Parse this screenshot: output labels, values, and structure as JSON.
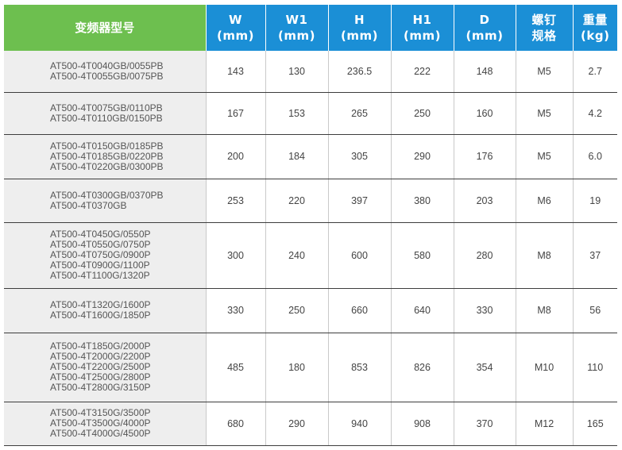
{
  "headers": {
    "model": "变频器型号",
    "w": {
      "label": "W",
      "unit": "(mm)"
    },
    "w1": {
      "label": "W1",
      "unit": "(mm)"
    },
    "h": {
      "label": "H",
      "unit": "(mm)"
    },
    "h1": {
      "label": "H1",
      "unit": "(mm)"
    },
    "d": {
      "label": "D",
      "unit": "(mm)"
    },
    "screw": {
      "line1": "螺钉",
      "line2": "规格"
    },
    "weight": {
      "line1": "重量",
      "line2": "(kg)"
    }
  },
  "rows": [
    {
      "models": [
        "AT500-4T0040GB/0055PB",
        "AT500-4T0055GB/0075PB"
      ],
      "w": "143",
      "w1": "130",
      "h": "236.5",
      "h1": "222",
      "d": "148",
      "screw": "M5",
      "weight": "2.7"
    },
    {
      "models": [
        "AT500-4T0075GB/0110PB",
        "AT500-4T0110GB/0150PB"
      ],
      "w": "167",
      "w1": "153",
      "h": "265",
      "h1": "250",
      "d": "160",
      "screw": "M5",
      "weight": "4.2"
    },
    {
      "models": [
        "AT500-4T0150GB/0185PB",
        "AT500-4T0185GB/0220PB",
        "AT500-4T0220GB/0300PB"
      ],
      "w": "200",
      "w1": "184",
      "h": "305",
      "h1": "290",
      "d": "176",
      "screw": "M5",
      "weight": "6.0"
    },
    {
      "models": [
        "AT500-4T0300GB/0370PB",
        "AT500-4T0370GB"
      ],
      "w": "253",
      "w1": "220",
      "h": "397",
      "h1": "380",
      "d": "203",
      "screw": "M6",
      "weight": "19"
    },
    {
      "models": [
        "AT500-4T0450G/0550P",
        "AT500-4T0550G/0750P",
        "AT500-4T0750G/0900P",
        "AT500-4T0900G/1100P",
        "AT500-4T1100G/1320P"
      ],
      "w": "300",
      "w1": "240",
      "h": "600",
      "h1": "580",
      "d": "280",
      "screw": "M8",
      "weight": "37"
    },
    {
      "models": [
        "AT500-4T1320G/1600P",
        "AT500-4T1600G/1850P"
      ],
      "w": "330",
      "w1": "250",
      "h": "660",
      "h1": "640",
      "d": "330",
      "screw": "M8",
      "weight": "56"
    },
    {
      "models": [
        "AT500-4T1850G/2000P",
        "AT500-4T2000G/2200P",
        "AT500-4T2200G/2500P",
        "AT500-4T2500G/2800P",
        "AT500-4T2800G/3150P"
      ],
      "w": "485",
      "w1": "180",
      "h": "853",
      "h1": "826",
      "d": "354",
      "screw": "M10",
      "weight": "110"
    },
    {
      "models": [
        "AT500-4T3150G/3500P",
        "AT500-4T3500G/4000P",
        "AT500-4T4000G/4500P"
      ],
      "w": "680",
      "w1": "290",
      "h": "940",
      "h1": "908",
      "d": "370",
      "screw": "M12",
      "weight": "165"
    }
  ],
  "colors": {
    "model_header": "#6dbf4f",
    "dim_header": "#1b8fd6",
    "model_cell": "#eeeeee"
  }
}
